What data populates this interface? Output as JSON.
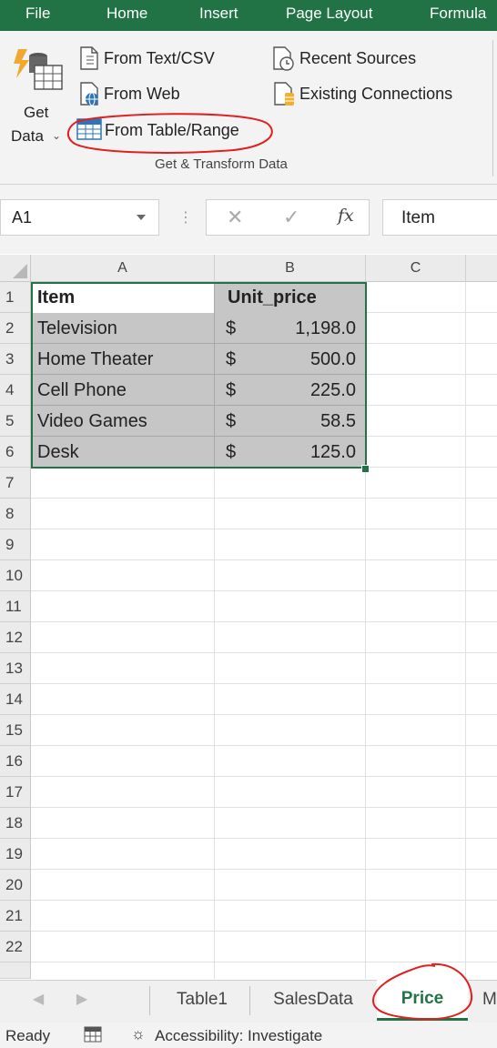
{
  "ribbon_tabs": [
    "File",
    "Home",
    "Insert",
    "Page Layout",
    "Formula"
  ],
  "ribbon": {
    "get_data_line1": "Get",
    "get_data_line2": "Data",
    "from_text_csv": "From Text/CSV",
    "from_web": "From Web",
    "from_table_range": "From Table/Range",
    "recent_sources": "Recent Sources",
    "existing_connections": "Existing Connections",
    "group_label": "Get & Transform Data"
  },
  "formula_bar": {
    "name_box": "A1",
    "fx_symbol": "fx",
    "content": "Item"
  },
  "columns": [
    "A",
    "B",
    "C"
  ],
  "rows": [
    "1",
    "2",
    "3",
    "4",
    "5",
    "6",
    "7",
    "8",
    "9",
    "10",
    "11",
    "12",
    "13",
    "14",
    "15",
    "16",
    "17",
    "18",
    "19",
    "20",
    "21",
    "22"
  ],
  "table": {
    "header": {
      "item": "Item",
      "price": "Unit_price"
    },
    "rows": [
      {
        "item": "Television",
        "currency": "$",
        "price": "1,198.0"
      },
      {
        "item": "Home Theater",
        "currency": "$",
        "price": "500.0"
      },
      {
        "item": "Cell Phone",
        "currency": "$",
        "price": "225.0"
      },
      {
        "item": "Video Games",
        "currency": "$",
        "price": "58.5"
      },
      {
        "item": "Desk",
        "currency": "$",
        "price": "125.0"
      }
    ]
  },
  "sheet_tabs": [
    "Table1",
    "SalesData",
    "Price",
    "M"
  ],
  "active_sheet": "Price",
  "status": {
    "ready": "Ready",
    "accessibility": "Accessibility: Investigate"
  },
  "colors": {
    "accent": "#217346",
    "annotation": "#e02020",
    "selection_fill": "#c6c6c6"
  }
}
